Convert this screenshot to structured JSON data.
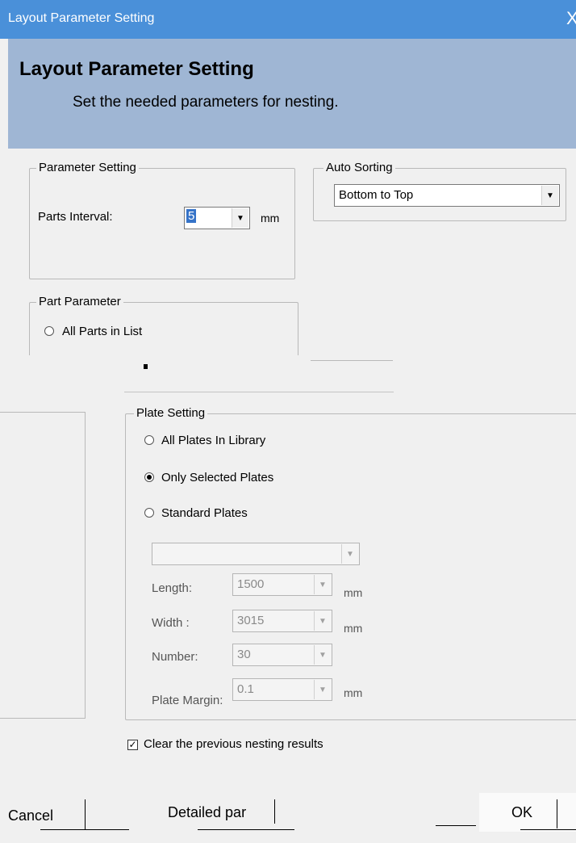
{
  "window": {
    "title": "Layout Parameter Setting",
    "close_glyph": "X",
    "header_title": "Layout Parameter Setting",
    "header_subtitle": "Set the needed parameters for nesting."
  },
  "parameter_setting": {
    "legend": "Parameter Setting",
    "parts_interval_label": "Parts Interval:",
    "parts_interval_value": "5",
    "unit": "mm"
  },
  "auto_sorting": {
    "legend": "Auto Sorting",
    "selected": "Bottom to Top"
  },
  "part_parameter": {
    "legend": "Part Parameter",
    "option_all": "All Parts in List"
  },
  "plate_setting": {
    "legend": "Plate Setting",
    "option_all": "All Plates In Library",
    "option_selected": "Only Selected Plates",
    "option_standard": "Standard Plates",
    "selected_option": "Only Selected Plates",
    "plate_combo_value": "",
    "length_label": "Length:",
    "length_value": "1500",
    "width_label": "Width :",
    "width_value": "3015",
    "number_label": "Number:",
    "number_value": "30",
    "margin_label": "Plate Margin:",
    "margin_value": "0.1",
    "unit": "mm"
  },
  "options": {
    "clear_label": "Clear the previous nesting results",
    "clear_checked": true
  },
  "buttons": {
    "cancel": "Cancel",
    "detailed": "Detailed par",
    "ok": "OK"
  },
  "icons": {
    "dropdown": "chevron-down-icon",
    "check": "checkmark-icon"
  }
}
